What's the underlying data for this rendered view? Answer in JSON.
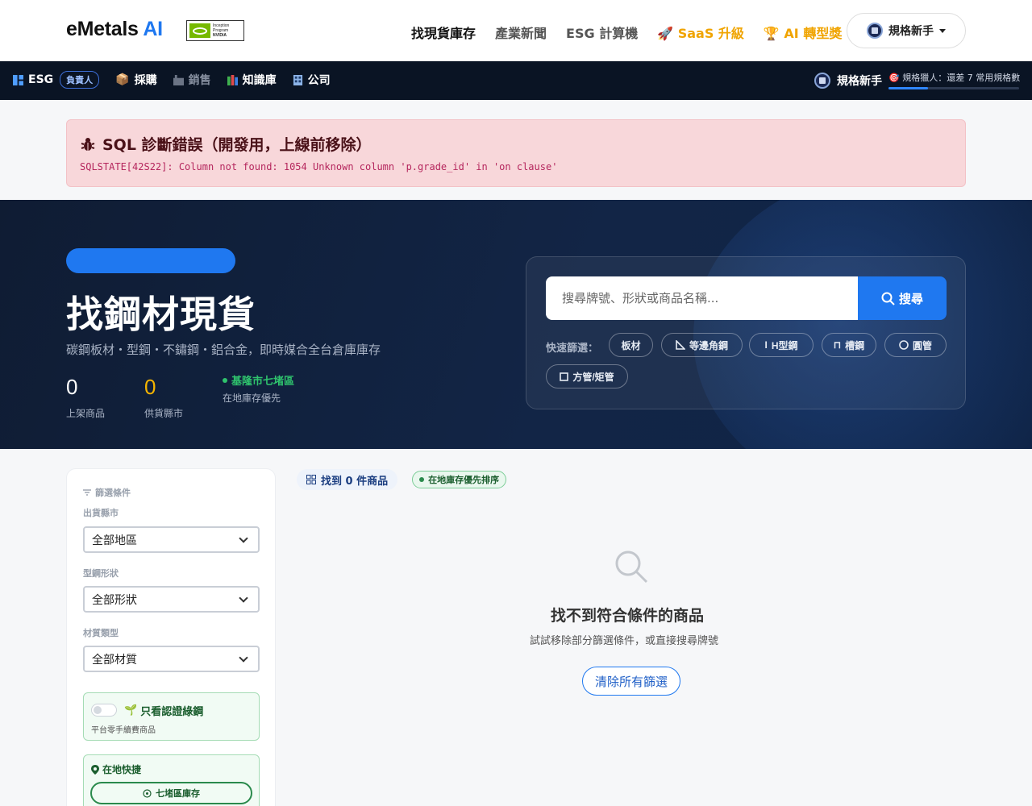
{
  "brand": {
    "name": "eMetals",
    "ai": "AI",
    "badge_line1": "Inception",
    "badge_line2": "Program",
    "badge_mark": "NVIDIA"
  },
  "nav": {
    "items": [
      {
        "label": "找現貨庫存"
      },
      {
        "label": "產業新聞"
      },
      {
        "label": "ESG 計算機"
      },
      {
        "label": "SaaS 升級"
      },
      {
        "label": "AI 轉型獎"
      }
    ],
    "user": "規格新手"
  },
  "subnav": {
    "esg": "ESG",
    "role": "負責人",
    "items": [
      "採購",
      "銷售",
      "知識庫",
      "公司"
    ],
    "user": "規格新手",
    "xp_text": "規格獵人：還差 7 常用規格數",
    "xp_progress": 0.3
  },
  "error": {
    "title": "SQL 診斷錯誤（開發用，上線前移除）",
    "message": "SQLSTATE[42S22]: Column not found: 1054 Unknown column 'p.grade_id' in 'on clause'"
  },
  "hero": {
    "title": "找鋼材現貨",
    "subtitle": "碳鋼板材・型鋼・不鏽鋼・鋁合金，即時媒合全台倉庫庫存",
    "stats": [
      {
        "value": "0",
        "label": "上架商品"
      },
      {
        "value": "0",
        "label": "供貨縣市"
      }
    ],
    "location": {
      "city": "基隆市七堵區",
      "label": "在地庫存優先"
    },
    "search": {
      "placeholder": "搜尋牌號、形狀或商品名稱...",
      "button": "搜尋"
    },
    "quick_label": "快速篩選：",
    "chips": [
      "板材",
      "等邊角鋼",
      "H型鋼",
      "槽鋼",
      "圓管",
      "方管/矩管"
    ]
  },
  "sidebar": {
    "heading": "篩選條件",
    "filters": [
      {
        "label": "出貨縣市",
        "value": "全部地區"
      },
      {
        "label": "型鋼形狀",
        "value": "全部形狀"
      },
      {
        "label": "材質類型",
        "value": "全部材質"
      }
    ],
    "green": {
      "title": "只看認證綠鋼",
      "subtitle": "平台零手續費商品"
    },
    "local": {
      "title": "在地快捷",
      "button": "七堵區庫存"
    }
  },
  "results": {
    "found": "找到 0 件商品",
    "badge": "在地庫存優先排序",
    "empty_title": "找不到符合條件的商品",
    "empty_sub": "試試移除部分篩選條件，或直接搜尋牌號",
    "clear": "清除所有篩選"
  },
  "colors": {
    "primary": "#1f78f0",
    "gold": "#f0a400",
    "green": "#2fc36d",
    "navy": "#0a1424"
  }
}
